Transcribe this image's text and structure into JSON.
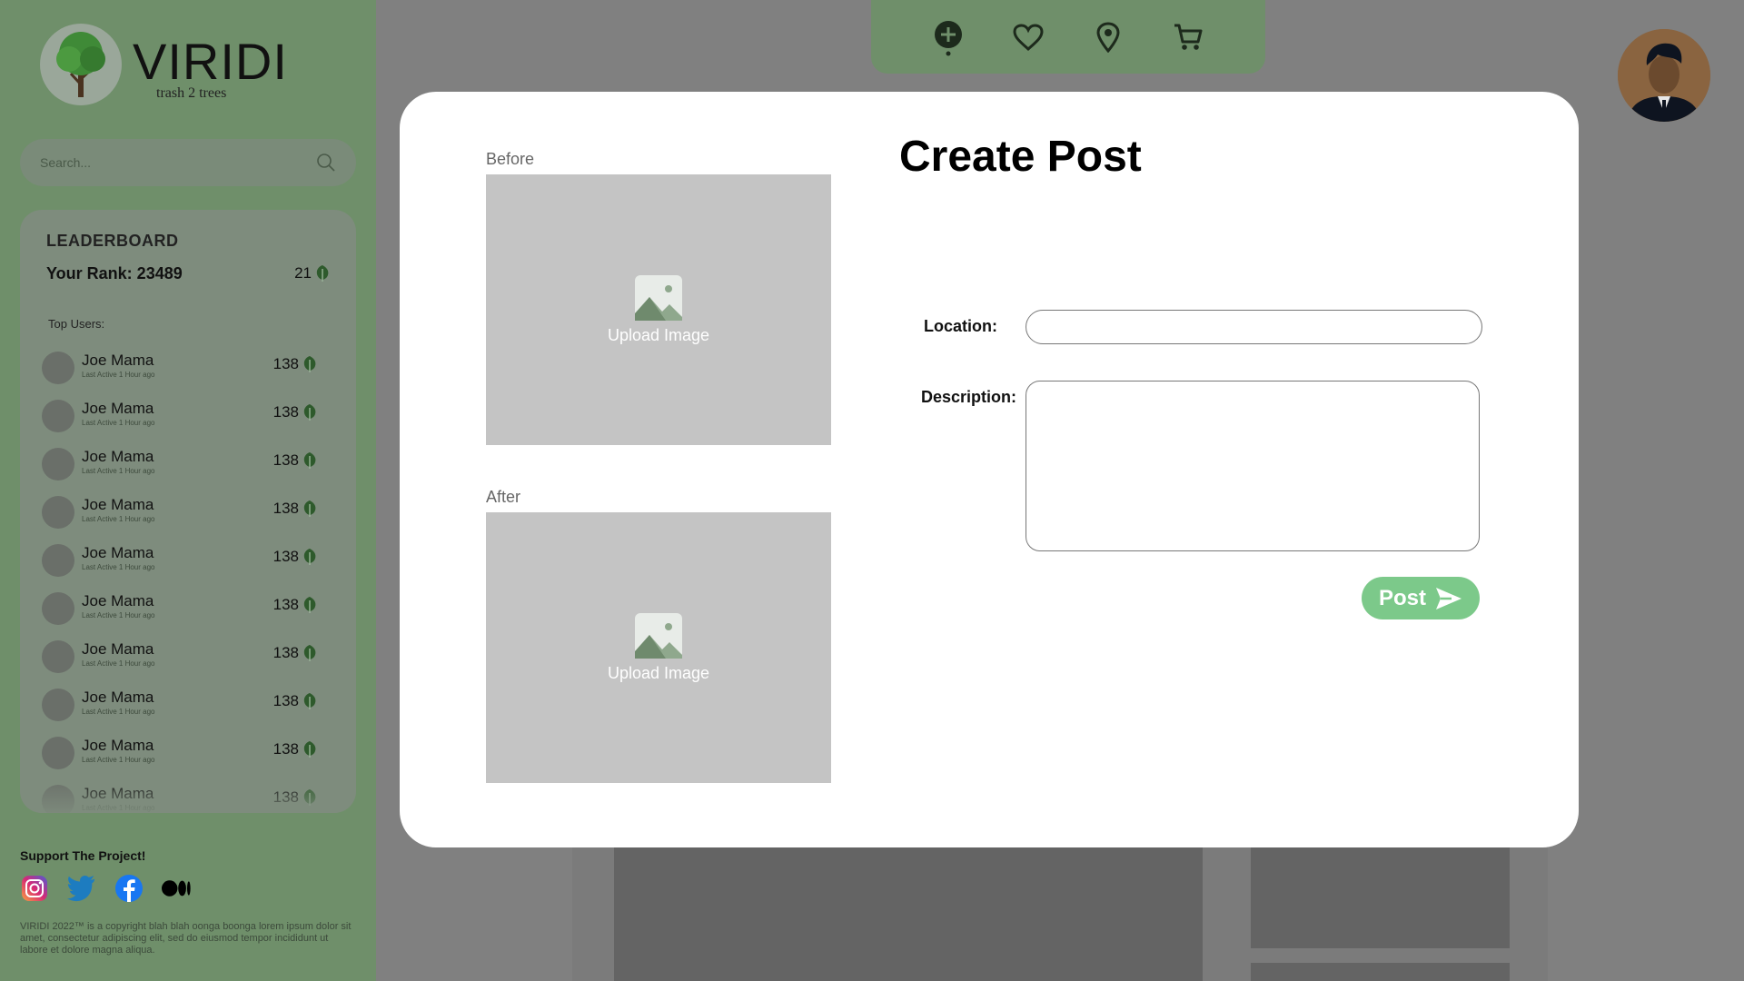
{
  "brand": {
    "title": "VIRIDI",
    "tagline": "trash 2 trees"
  },
  "search": {
    "placeholder": "Search..."
  },
  "leaderboard": {
    "title": "LEADERBOARD",
    "rank_label": "Your Rank: 23489",
    "rank_score": "21",
    "top_users_label": "Top Users:",
    "users": [
      {
        "name": "Joe Mama",
        "sub": "Last Active 1 Hour ago",
        "score": "138"
      },
      {
        "name": "Joe Mama",
        "sub": "Last Active 1 Hour ago",
        "score": "138"
      },
      {
        "name": "Joe Mama",
        "sub": "Last Active 1 Hour ago",
        "score": "138"
      },
      {
        "name": "Joe Mama",
        "sub": "Last Active 1 Hour ago",
        "score": "138"
      },
      {
        "name": "Joe Mama",
        "sub": "Last Active 1 Hour ago",
        "score": "138"
      },
      {
        "name": "Joe Mama",
        "sub": "Last Active 1 Hour ago",
        "score": "138"
      },
      {
        "name": "Joe Mama",
        "sub": "Last Active 1 Hour ago",
        "score": "138"
      },
      {
        "name": "Joe Mama",
        "sub": "Last Active 1 Hour ago",
        "score": "138"
      },
      {
        "name": "Joe Mama",
        "sub": "Last Active 1 Hour ago",
        "score": "138"
      },
      {
        "name": "Joe Mama",
        "sub": "Last Active 1 Hour ago",
        "score": "138"
      }
    ]
  },
  "support": {
    "title": "Support The Project!",
    "socials": [
      "instagram-icon",
      "twitter-icon",
      "facebook-icon",
      "medium-icon"
    ]
  },
  "footer": {
    "text": "VIRIDI 2022™ is a copyright blah blah oonga boonga lorem ipsum dolor sit amet, consectetur adipiscing elit, sed do eiusmod tempor incididunt ut labore et dolore magna aliqua."
  },
  "topnav": {
    "icons": [
      "add-post-icon",
      "heart-icon",
      "location-pin-icon",
      "cart-icon"
    ]
  },
  "modal": {
    "title": "Create Post",
    "before_label": "Before",
    "after_label": "After",
    "upload_label": "Upload Image",
    "location_label": "Location:",
    "location_value": "",
    "description_label": "Description:",
    "description_value": "",
    "post_label": "Post"
  },
  "colors": {
    "sidebar": "#6f8f6a",
    "accent": "#7cc98a",
    "overlay": "#808080"
  }
}
